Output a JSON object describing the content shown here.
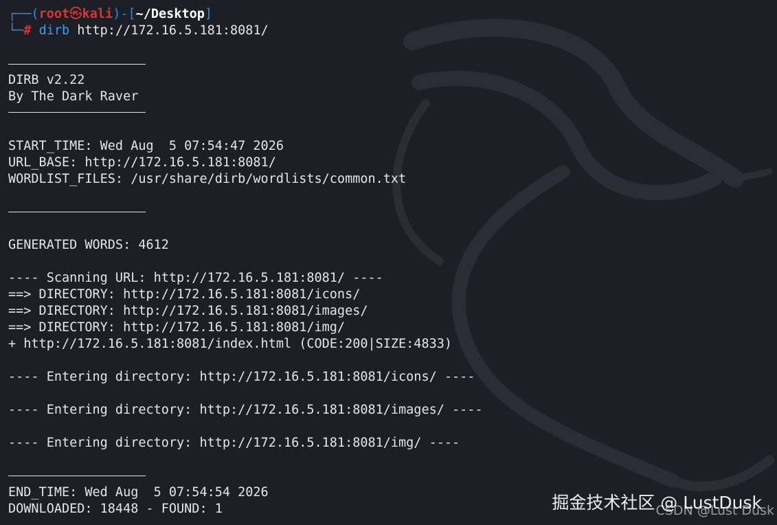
{
  "prompt": {
    "bracket_open": "┌──(",
    "user": "root",
    "skull": "㉿",
    "host": "kali",
    "bracket_mid": ")-[",
    "path": "~/Desktop",
    "bracket_close": "]",
    "corner": "└─",
    "hash": "#",
    "command": "dirb",
    "argument": "http://172.16.5.181:8081/"
  },
  "banner": {
    "title": "DIRB v2.22",
    "author": "By The Dark Raver"
  },
  "info": {
    "start_time": "START_TIME: Wed Aug  5 07:54:47 2026",
    "url_base": "URL_BASE: http://172.16.5.181:8081/",
    "wordlist": "WORDLIST_FILES: /usr/share/dirb/wordlists/common.txt"
  },
  "generated_words": "GENERATED WORDS: 4612",
  "scan": {
    "header": "---- Scanning URL: http://172.16.5.181:8081/ ----",
    "results": [
      "==> DIRECTORY: http://172.16.5.181:8081/icons/",
      "==> DIRECTORY: http://172.16.5.181:8081/images/",
      "==> DIRECTORY: http://172.16.5.181:8081/img/",
      "+ http://172.16.5.181:8081/index.html (CODE:200|SIZE:4833)"
    ]
  },
  "entering": [
    "---- Entering directory: http://172.16.5.181:8081/icons/ ----",
    "---- Entering directory: http://172.16.5.181:8081/images/ ----",
    "---- Entering directory: http://172.16.5.181:8081/img/ ----"
  ],
  "summary": {
    "end_time": "END_TIME: Wed Aug  5 07:54:54 2026",
    "downloaded": "DOWNLOADED: 18448 - FOUND: 1"
  },
  "watermark": {
    "primary": "掘金技术社区 @ LustDusk",
    "secondary": "CSDN @Lust Dusk"
  }
}
